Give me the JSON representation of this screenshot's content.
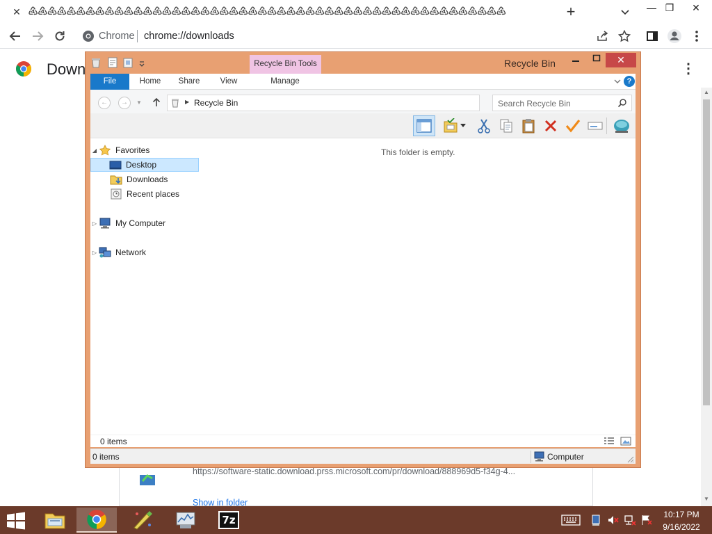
{
  "browser": {
    "tab_strip_icons": "♶♶♶♶♶♶♶♶♶♶♶♶♶♶♶♶♶♶♶♶♶♶♶♶♶♶♶♶♶♶♶♶♶♶♶♶♶♶♶♶♶♶♶♶♶♶♶♶♶♶",
    "tab_close": "✕",
    "new_tab": "+",
    "omnibox_label": "Chrome",
    "omnibox_url": "chrome://downloads",
    "window_controls": {
      "minimize": "—",
      "restore": "❐",
      "close": "✕"
    }
  },
  "downloads_page": {
    "title": "Down",
    "menu": "⋮",
    "item": {
      "url": "https://software-static.download.prss.microsoft.com/pr/download/888969d5-f34g-4...",
      "show_in_folder": "Show in folder"
    }
  },
  "explorer": {
    "title": "Recycle Bin",
    "contextual_tab": "Recycle Bin Tools",
    "ribbon_tabs": [
      "File",
      "Home",
      "Share",
      "View",
      "Manage"
    ],
    "address": "Recycle Bin",
    "search_placeholder": "Search Recycle Bin",
    "nav": {
      "favorites": "Favorites",
      "desktop": "Desktop",
      "downloads": "Downloads",
      "recent": "Recent places",
      "my_computer": "My Computer",
      "network": "Network"
    },
    "empty_message": "This folder is empty.",
    "status_inner": "0 items",
    "status_items": "0 items",
    "status_location": "Computer",
    "help": "?",
    "colors": {
      "frame": "#e8a072",
      "close": "#c74848",
      "accent": "#1979ca",
      "context_tab": "#f0c4e4"
    }
  },
  "taskbar": {
    "time": "10:17 PM",
    "date": "9/16/2022",
    "apps": [
      "file-explorer",
      "chrome",
      "paint-tool",
      "performance-monitor",
      "7zip"
    ],
    "seven_zip_label": "7z",
    "color": "#6b3a2a"
  }
}
